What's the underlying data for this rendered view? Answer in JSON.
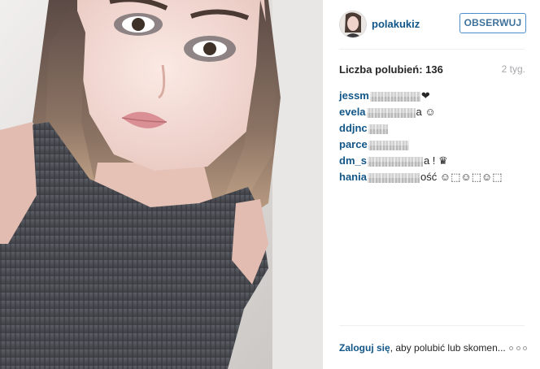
{
  "post": {
    "image": {
      "alt_icon": "selfie-photo"
    },
    "author": {
      "username": "polakukiz",
      "follow_label": "OBSERWUJ"
    },
    "likes_text": "Liczba polubień: 136",
    "time_ago": "2 tyg.",
    "comments": [
      {
        "user": "jessm",
        "tail": ""
      },
      {
        "user": "evela",
        "tail": "a ☺"
      },
      {
        "user": "ddjnc",
        "tail": ""
      },
      {
        "user": "parce",
        "tail": ""
      },
      {
        "user": "dm_s",
        "tail": "a ! ♛"
      },
      {
        "user": "hania",
        "tail": "ość ☺⬚☺⬚☺⬚"
      }
    ],
    "login": {
      "link": "Zaloguj się",
      "rest": ", aby polubić lub skomen..."
    },
    "more_icon": "more-options-icon"
  }
}
